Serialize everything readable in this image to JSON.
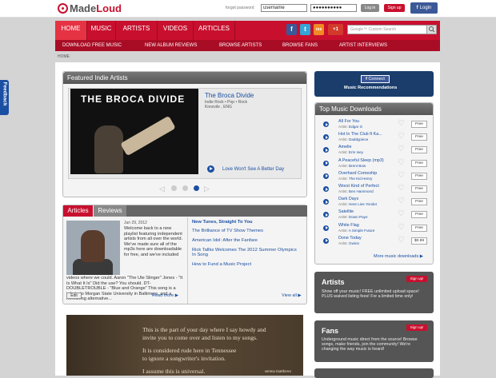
{
  "header": {
    "logo_part1": "Made",
    "logo_part2": "Loud",
    "forgot_password": "forgot password",
    "username_value": "username",
    "password_value": "●●●●●●●●●●",
    "login_label": "Log in",
    "signup_label": "Sign up",
    "fb_login_label": "Login"
  },
  "nav": {
    "items": [
      "HOME",
      "MUSIC",
      "ARTISTS",
      "VIDEOS",
      "ARTICLES"
    ],
    "active": "HOME",
    "sub_items": [
      "DOWNLOAD FREE MUSIC",
      "NEW ALBUM REVIEWS",
      "BROWSE ARTISTS",
      "BROWSE FANS",
      "ARTIST INTERVIEWS"
    ],
    "search_placeholder": "Google™ Custom Search",
    "social": [
      "f",
      "t",
      "rss",
      "+1"
    ]
  },
  "breadcrumb": "HOME",
  "feedback": "Feedback",
  "featured": {
    "heading": "Featured Indie Artists",
    "band_image_text": "THE BROCA DIVIDE",
    "artist_name": "The Broca Divide",
    "genres": "Indie Rock • Pop • Rock",
    "location": "Knoxvile , ENG",
    "song": "Love Won't See A Better Day",
    "carousel_active": 3
  },
  "articles": {
    "tab_articles": "Articles",
    "tab_reviews": "Reviews",
    "date": "Jun 29, 2012",
    "text_right": "Welcome back to a new playlist featuring independent artists from all over the world. We've made sure all of the mp3s here are downloadable for free, and we've included",
    "text_below": "videos where we could. Aaron \"The Ute Slinger\" Jones - \"It Is What It Is\" Did the use? You should. DT-DOUBLETROUBLE - \"Blue and Orange\" This song is a tribute to Morgan State University in Baltimore, and a refreshing alternative...",
    "related": [
      "New Tunes, Straight To You",
      "The Brilliance of TV Show Themes",
      "American Idol: After the Fanfare",
      "Rick Tallks Welcomes The 2012 Summer Olympics In Song",
      "How to Fund a Music Project"
    ],
    "edit": "Edit",
    "read_more": "Read more",
    "view_all": "View all"
  },
  "quote": {
    "lines": [
      "This is the part of your day where I say howdy and",
      "invite you to come over and listen to my songs.",
      "It is considered rude here in Tennessee",
      "to ignore a songwriter's invitation.",
      "I assume this is universal."
    ],
    "signature": "serena matthews"
  },
  "facebook": {
    "connect": "Connect",
    "caption": "Music Recommendations"
  },
  "downloads": {
    "heading": "Top Music Downloads",
    "artist_label": "Artist:",
    "items": [
      {
        "title": "All For You",
        "artist": "Edgar G",
        "price": "Free"
      },
      {
        "title": "Hot In The Club ft Ka...",
        "artist": "Daddypiece",
        "price": "Free"
      },
      {
        "title": "Amelie",
        "artist": "Erin Ivey",
        "price": "Free"
      },
      {
        "title": "A Peaceful Sleep (mp3)",
        "artist": "Brent Bow",
        "price": "Free"
      },
      {
        "title": "Overhard Comeship",
        "artist": "The Kid Henry",
        "price": "Free"
      },
      {
        "title": "Worst Kind of Perfect",
        "artist": "Ben Hammond",
        "price": "Free"
      },
      {
        "title": "Dark Days",
        "artist": "Here Lies Yonder",
        "price": "Free"
      },
      {
        "title": "Satellite",
        "artist": "Down Paye",
        "price": "Free"
      },
      {
        "title": "White Flag",
        "artist": "A Simple Future",
        "price": "Free"
      },
      {
        "title": "Done Today",
        "artist": "Gwinn",
        "price": "$0.99"
      }
    ],
    "more": "More music downloads"
  },
  "artists_box": {
    "heading": "Artists",
    "signup": "Sign up!",
    "text": "Show off your music! FREE unlimited upload space! PLUS waived listing fees! For a limited time only!"
  },
  "fans_box": {
    "heading": "Fans",
    "signup": "Sign up!",
    "text": "Underground music direct from the source! Browse songs, make friends, join the community! We're changing the way music is heard!"
  }
}
